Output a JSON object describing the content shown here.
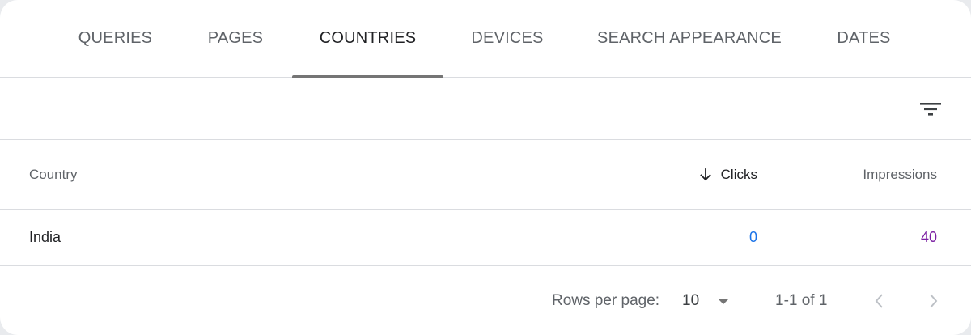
{
  "tabs": [
    {
      "label": "QUERIES"
    },
    {
      "label": "PAGES"
    },
    {
      "label": "COUNTRIES",
      "active": true
    },
    {
      "label": "DEVICES"
    },
    {
      "label": "SEARCH APPEARANCE"
    },
    {
      "label": "DATES"
    }
  ],
  "filter": {
    "icon": "filter-icon"
  },
  "table": {
    "headers": {
      "country": "Country",
      "clicks": "Clicks",
      "impressions": "Impressions",
      "sort_icon": "arrow-down-icon"
    },
    "rows": [
      {
        "country": "India",
        "clicks": "0",
        "impressions": "40"
      }
    ]
  },
  "pagination": {
    "rows_per_page_label": "Rows per page:",
    "rows_per_page_value": "10",
    "range": "1-1 of 1"
  },
  "colors": {
    "clicks": "#1a73e8",
    "impressions": "#7b1fa2",
    "active_tab_underline": "#757575"
  }
}
